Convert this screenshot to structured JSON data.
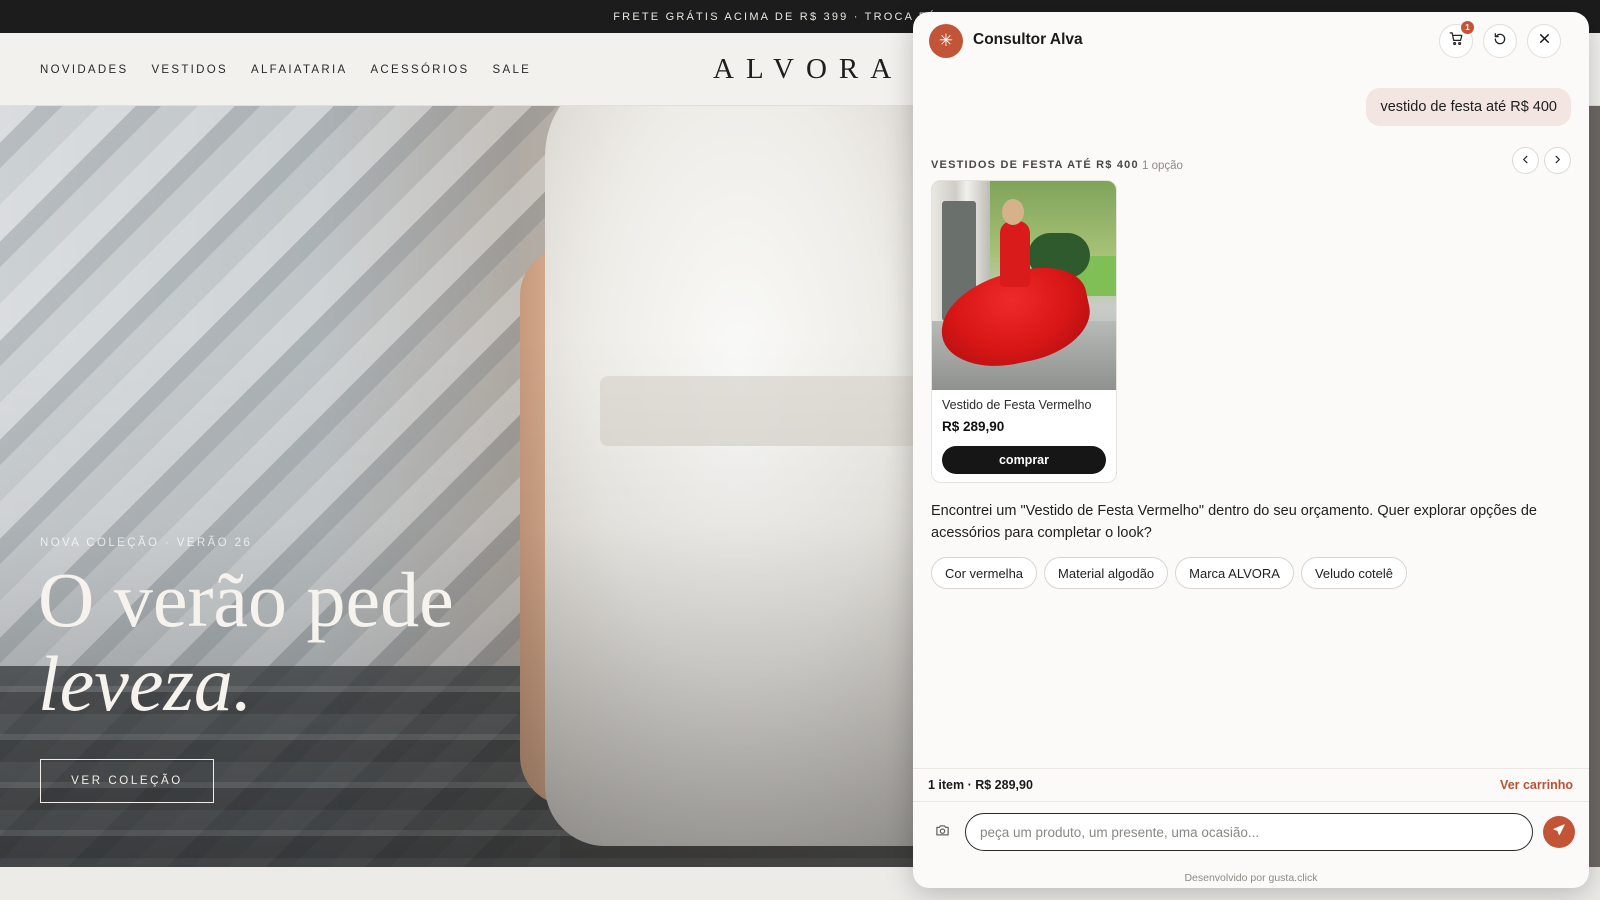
{
  "announcement": "FRETE GRÁTIS ACIMA DE R$ 399 · TROCA FÁCIL EM",
  "header": {
    "nav": [
      "NOVIDADES",
      "VESTIDOS",
      "ALFAIATARIA",
      "ACESSÓRIOS",
      "SALE"
    ],
    "logo": "ALVORA"
  },
  "hero": {
    "eyebrow": "NOVA COLEÇÃO · VERÃO 26",
    "line1": "O verão pede",
    "line2": "leveza.",
    "button": "VER COLEÇÃO"
  },
  "chat": {
    "title": "Consultor Alva",
    "cart_count": "1",
    "user_message": "vestido de festa até R$ 400",
    "section_title": "VESTIDOS DE FESTA ATÉ R$ 400",
    "section_count": "1 opção",
    "product": {
      "name": "Vestido de Festa Vermelho",
      "price": "R$ 289,90",
      "buy_label": "comprar"
    },
    "assistant_message": "Encontrei um \"Vestido de Festa Vermelho\" dentro do seu orçamento. Quer explorar opções de acessórios para completar o look?",
    "suggestions": [
      "Cor vermelha",
      "Material algodão",
      "Marca ALVORA",
      "Veludo cotelê"
    ],
    "cart_summary": "1 item · R$ 289,90",
    "cart_link": "Ver carrinho",
    "input_placeholder": "peça um produto, um presente, uma ocasião...",
    "footer": "Desenvolvido por gusta.click"
  },
  "colors": {
    "accent": "#c25438",
    "topbar": "#1c1c1c",
    "header_bg": "#f3f1ed",
    "user_bubble": "#f3e5e1"
  },
  "icons": {
    "avatar": "sparkle-icon",
    "cart": "cart-icon",
    "reset": "refresh-icon",
    "close": "close-icon",
    "prev": "chevron-left-icon",
    "next": "chevron-right-icon",
    "camera": "camera-icon",
    "send": "send-icon"
  }
}
